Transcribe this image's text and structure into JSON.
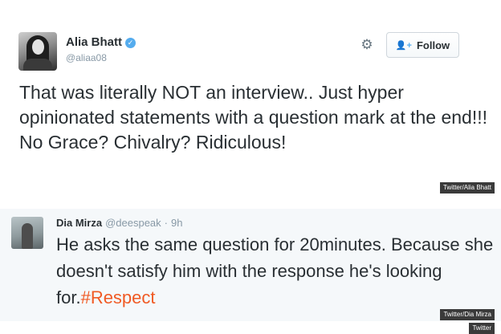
{
  "tweet1": {
    "name": "Alia Bhatt",
    "handle": "@aliaa08",
    "follow_label": "Follow",
    "text": "That was literally NOT an interview.. Just hyper opinionated statements with a question mark at the end!!! No Grace? Chivalry? Ridiculous!",
    "credit": "Twitter/Alia Bhatt",
    "icons": {
      "settings": "gear-icon",
      "follow": "add-user-icon",
      "verified": "verified-badge-icon"
    }
  },
  "tweet2": {
    "name": "Dia Mirza",
    "handle": "@deespeak",
    "separator": "·",
    "time": "9h",
    "text": "He asks the same question for 20minutes. Because she doesn't satisfy him with the response he's looking for.",
    "hashtag": "#Respect",
    "credit": "Twitter/Dia Mirza"
  },
  "image_credit": "Twitter",
  "colors": {
    "text": "#292f33",
    "muted": "#8899a6",
    "accent": "#55acee",
    "hashtag": "#f05a24",
    "tweet2_background": "#f5f8fa"
  }
}
